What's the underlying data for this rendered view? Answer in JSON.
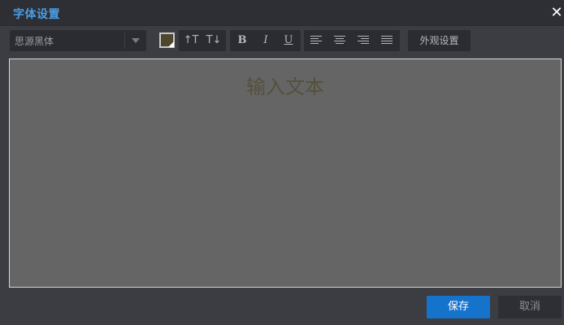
{
  "dialog": {
    "title": "字体设置",
    "close_icon": "close-icon"
  },
  "toolbar": {
    "font_family": "思源黑体",
    "text_color": "#4e462e",
    "increase_size_label": "↑T",
    "decrease_size_label": "T↓",
    "bold_label": "B",
    "italic_label": "I",
    "underline_label": "U",
    "align_icons": [
      "align-left-icon",
      "align-center-icon",
      "align-right-icon",
      "align-justify-icon"
    ],
    "appearance_label": "外观设置"
  },
  "editor": {
    "placeholder": "输入文本"
  },
  "footer": {
    "save_label": "保存",
    "cancel_label": "取消"
  },
  "colors": {
    "accent": "#1573cb",
    "title": "#4a9ee6"
  }
}
